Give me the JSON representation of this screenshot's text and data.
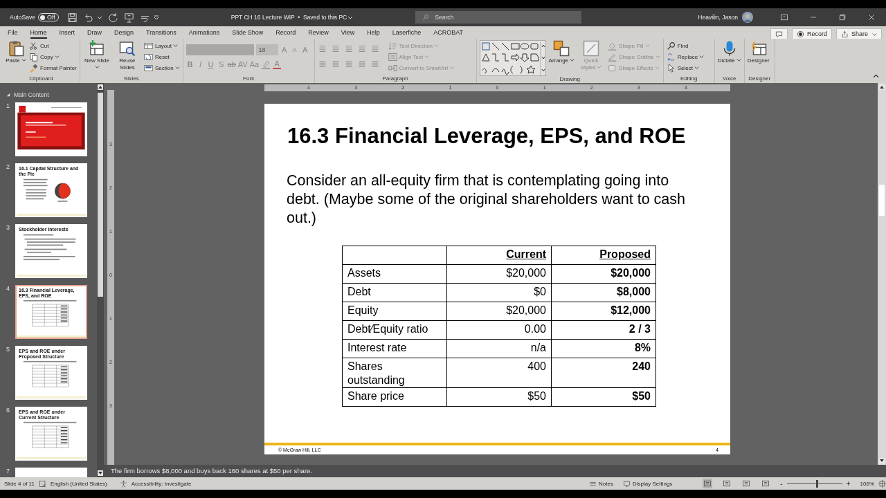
{
  "title_bar": {
    "autosave": "AutoSave",
    "toggle": {
      "label": "Off",
      "on": false
    },
    "title": "PPT CH 16 Lecture WIP  •  Saved to this PC",
    "search": {
      "placeholder": "Search"
    },
    "user": "Heavilin, Jason"
  },
  "ribbon": {
    "tabs": [
      {
        "label": "File",
        "selected": false
      },
      {
        "label": "Home",
        "selected": true
      },
      {
        "label": "Insert",
        "selected": false
      },
      {
        "label": "Draw",
        "selected": false
      },
      {
        "label": "Design",
        "selected": false
      },
      {
        "label": "Transitions",
        "selected": false
      },
      {
        "label": "Animations",
        "selected": false
      },
      {
        "label": "Slide Show",
        "selected": false
      },
      {
        "label": "Record",
        "selected": false
      },
      {
        "label": "Review",
        "selected": false
      },
      {
        "label": "View",
        "selected": false
      },
      {
        "label": "Help",
        "selected": false
      },
      {
        "label": "Laserfiche",
        "selected": false
      },
      {
        "label": "ACROBAT",
        "selected": false
      }
    ],
    "actions": [
      "Record",
      "Share"
    ],
    "groups": [
      {
        "kind": "stack",
        "label": "Clipboard",
        "columns": [
          [
            {
              "label": "Paste",
              "dropdown": true
            }
          ],
          [
            {
              "label": "Cut",
              "dropdown": false
            },
            {
              "label": "Copy",
              "dropdown": true
            },
            {
              "label": "Format Painter",
              "dropdown": false
            }
          ]
        ]
      },
      {
        "kind": "stack",
        "label": "Slides",
        "columns": [
          [
            {
              "label": "New Slide",
              "dropdown": true
            }
          ],
          [
            {
              "label": "Reuse Slides",
              "dropdown": false
            }
          ],
          [
            {
              "label": "Layout",
              "dropdown": true
            },
            {
              "label": "Reset",
              "dropdown": false
            },
            {
              "label": "Section",
              "dropdown": true
            }
          ]
        ]
      },
      {
        "kind": "font",
        "label": "Font",
        "disabled": true,
        "size": "18",
        "top_glyphs": [
          "A",
          "A",
          "A"
        ],
        "glyphs": [
          "B",
          "I",
          "U",
          "S",
          "ab",
          "AV",
          "Aa"
        ],
        "color_glyph": "A"
      },
      {
        "kind": "paragraph",
        "label": "Paragraph",
        "columns": [
          [
            {
              "label": "Text Direction",
              "dropdown": true,
              "disabled": true
            },
            {
              "label": "Align Text",
              "dropdown": true,
              "disabled": true
            },
            {
              "label": "Convert to SmartArt",
              "dropdown": true,
              "disabled": true
            }
          ]
        ]
      },
      {
        "kind": "drawing",
        "label": "Drawing",
        "columns": [
          [
            {
              "label": "Arrange",
              "dropdown": true,
              "disabled": false
            }
          ],
          [
            {
              "label": "Quick Styles",
              "dropdown": true,
              "disabled": true
            }
          ],
          [
            {
              "label": "Shape Fill",
              "dropdown": true,
              "disabled": true
            },
            {
              "label": "Shape Outline",
              "dropdown": true,
              "disabled": true
            },
            {
              "label": "Shape Effects",
              "dropdown": true,
              "disabled": true
            }
          ]
        ]
      },
      {
        "kind": "stack",
        "label": "Editing",
        "columns": [
          [
            {
              "label": "Find",
              "dropdown": false
            },
            {
              "label": "Replace",
              "dropdown": true
            },
            {
              "label": "Select",
              "dropdown": true
            }
          ]
        ]
      },
      {
        "kind": "stack",
        "label": "Voice",
        "columns": [
          [
            {
              "label": "Dictate",
              "dropdown": true
            }
          ]
        ]
      },
      {
        "kind": "stack",
        "label": "Designer",
        "columns": [
          [
            {
              "label": "Designer",
              "dropdown": false
            }
          ]
        ]
      }
    ]
  },
  "slide_pane": {
    "section": "Main Content",
    "thumbnails": [
      {
        "number": "1",
        "kind": "cover",
        "selected": false
      },
      {
        "number": "2",
        "kind": "pie",
        "title": "16.1 Capital Structure and the Pie",
        "selected": false
      },
      {
        "number": "3",
        "kind": "text",
        "title": "Stockholder Interests",
        "selected": false
      },
      {
        "number": "4",
        "kind": "table",
        "title": "16.3 Financial Leverage, EPS, and ROE",
        "selected": true
      },
      {
        "number": "5",
        "kind": "table",
        "title": "EPS and ROE under Proposed Structure",
        "selected": false
      },
      {
        "number": "6",
        "kind": "table",
        "title": "EPS and ROE under Current Structure",
        "selected": false
      },
      {
        "number": "7",
        "kind": "cut",
        "selected": false
      }
    ]
  },
  "rulers": {
    "horizontal": [
      "4",
      "3",
      "2",
      "1",
      "0",
      "1",
      "2",
      "3",
      "4"
    ],
    "vertical": [
      "3",
      "2",
      "1",
      "0",
      "1",
      "2",
      "3"
    ]
  },
  "slide": {
    "title": "16.3 Financial Leverage, EPS, and ROE",
    "body": "Consider an all-equity firm that is contemplating going into debt. (Maybe some of the original shareholders want to cash out.)",
    "table": {
      "columns": [
        "Current",
        "Proposed"
      ],
      "rows": [
        {
          "label": "Assets",
          "current": "$20,000",
          "proposed": "$20,000"
        },
        {
          "label": "Debt",
          "current": "$0",
          "proposed": "$8,000"
        },
        {
          "label": "Equity",
          "current": "$20,000",
          "proposed": "$12,000"
        },
        {
          "label": "Debt⁄Equity ratio",
          "current": "0.00",
          "proposed": "2 / 3"
        },
        {
          "label": "Interest rate",
          "current": "n/a",
          "proposed": "8%"
        },
        {
          "label": "Shares outstanding",
          "current": "400",
          "proposed": "240"
        },
        {
          "label": "Share price",
          "current": "$50",
          "proposed": "$50"
        }
      ]
    },
    "footer": "© McGraw Hill, LLC",
    "page": "4"
  },
  "notes": "The firm borrows $8,000 and buys back 160 shares at $50 per share.",
  "status_bar": {
    "slide": "Slide 4 of 11",
    "language": "English (United States)",
    "accessibility": "Accessibility: Investigate",
    "notes": "Notes",
    "display": "Display Settings",
    "views": [
      {
        "selected": true
      },
      {
        "selected": false
      },
      {
        "selected": false
      },
      {
        "selected": false
      }
    ],
    "zoom": {
      "minus": "-",
      "plus": "+",
      "level": 0.55,
      "reading": "106%"
    }
  }
}
